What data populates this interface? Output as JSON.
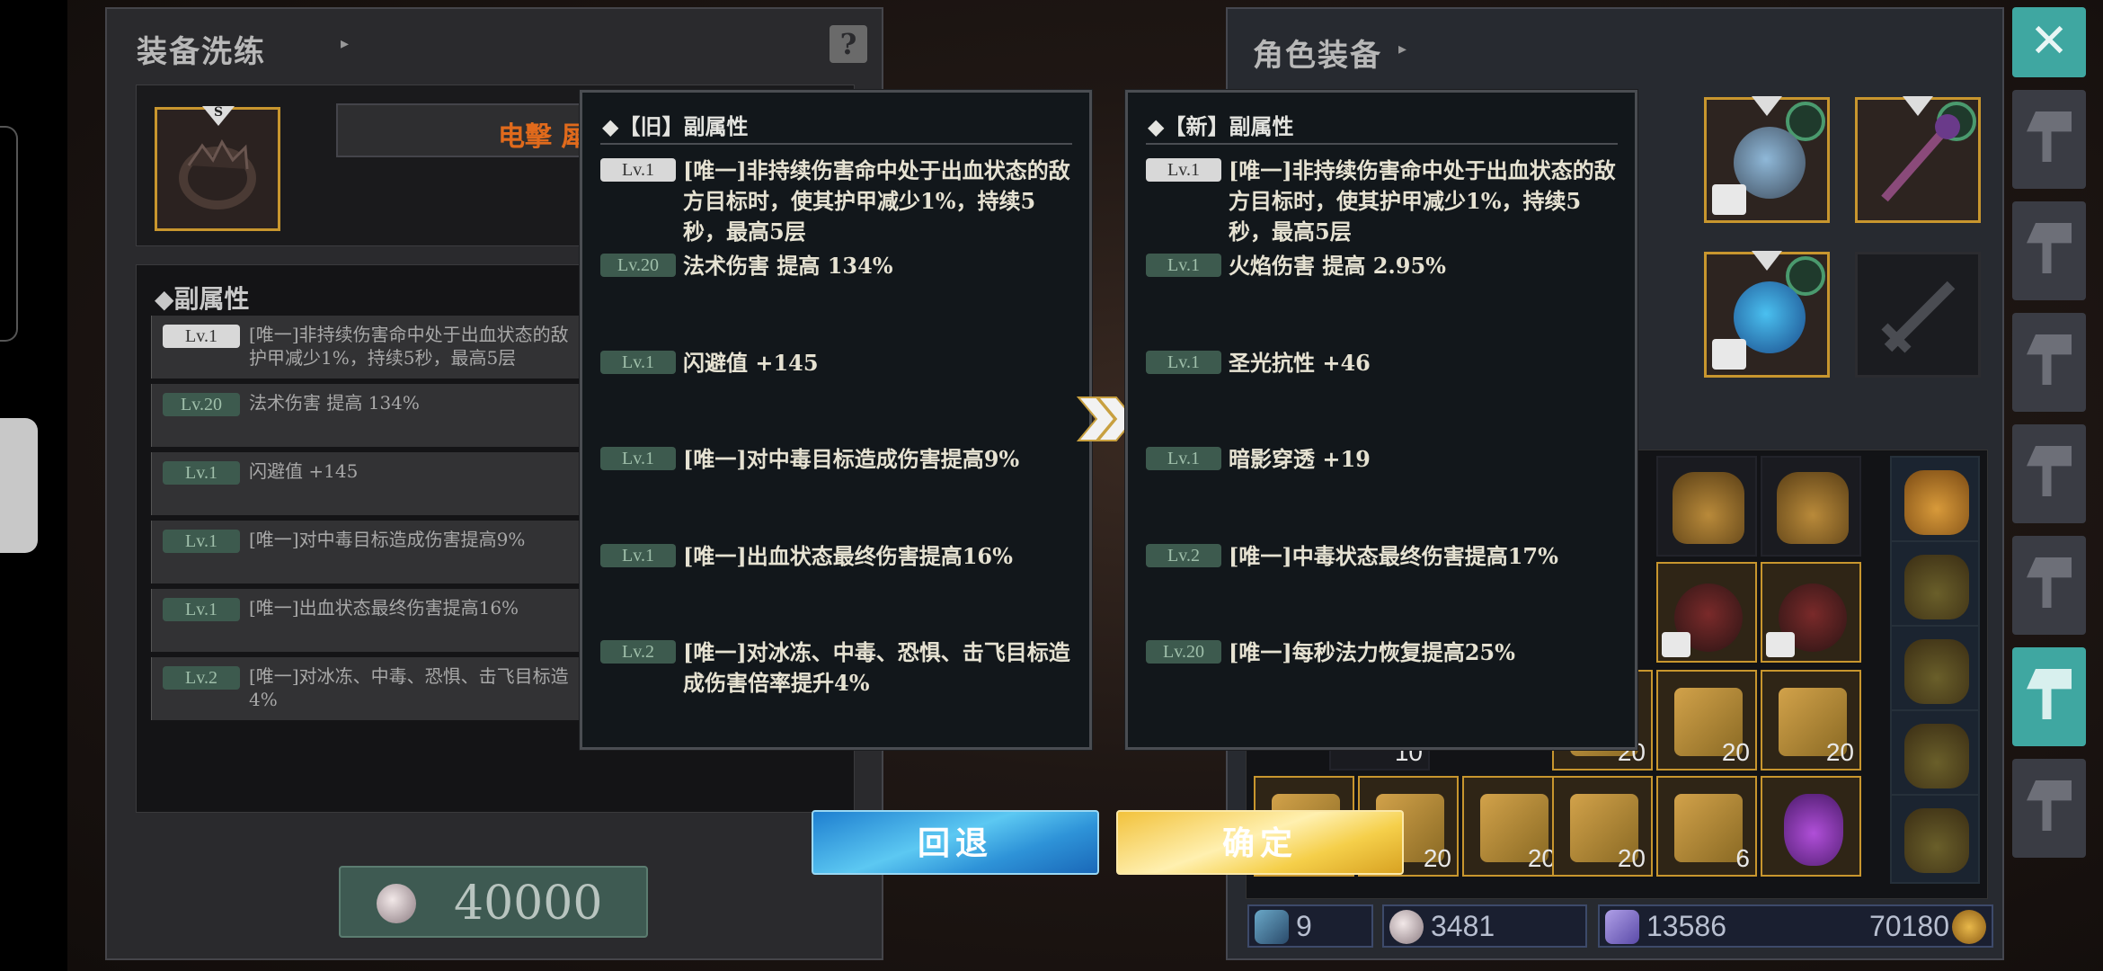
{
  "left_panel": {
    "title": "装备洗练",
    "equip_name": "电擊 犀牛",
    "attr_title": "◆副属性",
    "attributes": [
      {
        "lv": "Lv.1",
        "text": "[唯一]非持续伤害命中处于出血状态的敌\n护甲减少1%，持续5秒，最高5层"
      },
      {
        "lv": "Lv.20",
        "text": "法术伤害 提高 134%"
      },
      {
        "lv": "Lv.1",
        "text": "闪避值 +145"
      },
      {
        "lv": "Lv.1",
        "text": "[唯一]对中毒目标造成伤害提高9%"
      },
      {
        "lv": "Lv.1",
        "text": "[唯一]出血状态最终伤害提高16%"
      },
      {
        "lv": "Lv.2",
        "text": "[唯一]对冰冻、中毒、恐惧、击飞目标造\n4%"
      }
    ],
    "cost_value": "40000"
  },
  "right_panel": {
    "title": "角色装备",
    "inventory_counts": [
      "10",
      "20",
      "20",
      "20",
      "20",
      "20",
      "20",
      "20",
      "6"
    ],
    "resources": {
      "r1": "9",
      "r2": "3481",
      "r3": "13586",
      "r4": "70180"
    }
  },
  "popup_old": {
    "title": "◆【旧】副属性",
    "rows": [
      {
        "lv": "Lv.1",
        "text": "[唯一]非持续伤害命中处于出血状态的敌方目标时，使其护甲减少1%，持续5秒，最高5层"
      },
      {
        "lv": "Lv.20",
        "text": "法术伤害 提高 134%"
      },
      {
        "lv": "Lv.1",
        "text": "闪避值 +145"
      },
      {
        "lv": "Lv.1",
        "text": "[唯一]对中毒目标造成伤害提高9%"
      },
      {
        "lv": "Lv.1",
        "text": "[唯一]出血状态最终伤害提高16%"
      },
      {
        "lv": "Lv.2",
        "text": "[唯一]对冰冻、中毒、恐惧、击飞目标造成伤害倍率提升4%"
      }
    ]
  },
  "popup_new": {
    "title": "◆【新】副属性",
    "rows": [
      {
        "lv": "Lv.1",
        "text": "[唯一]非持续伤害命中处于出血状态的敌方目标时，使其护甲减少1%，持续5秒，最高5层"
      },
      {
        "lv": "Lv.1",
        "text": "火焰伤害 提高 2.95%"
      },
      {
        "lv": "Lv.1",
        "text": "圣光抗性 +46"
      },
      {
        "lv": "Lv.1",
        "text": "暗影穿透 +19"
      },
      {
        "lv": "Lv.2",
        "text": "[唯一]中毒状态最终伤害提高17%"
      },
      {
        "lv": "Lv.20",
        "text": "[唯一]每秒法力恢复提高25%"
      }
    ]
  },
  "buttons": {
    "back": "回退",
    "confirm": "确定",
    "close": "✕",
    "help": "?"
  },
  "icons": [
    "help-icon",
    "close-icon",
    "double-chevron-right-icon",
    "gem-icon",
    "hammer-icon",
    "lock-icon"
  ],
  "colors": {
    "accent_teal": "#3fa7a1",
    "item_gold_border": "#c8962e",
    "equip_name_orange": "#e06a1c",
    "back_blue": "#2e93d8",
    "confirm_yellow": "#f5cf4a"
  }
}
